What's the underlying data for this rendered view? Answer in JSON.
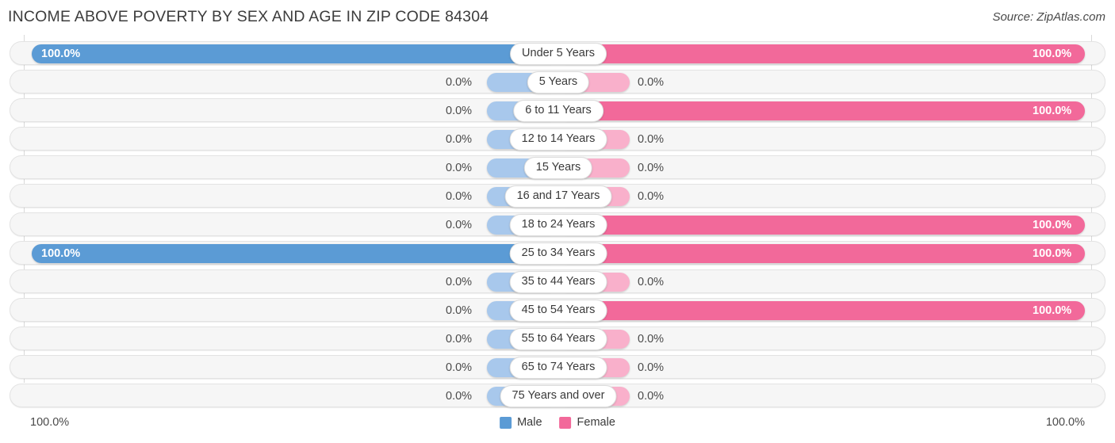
{
  "header": {
    "title": "INCOME ABOVE POVERTY BY SEX AND AGE IN ZIP CODE 84304",
    "source": "Source: ZipAtlas.com"
  },
  "footer": {
    "axis_left": "100.0%",
    "axis_right": "100.0%"
  },
  "legend": [
    {
      "label": "Male",
      "color": "#5b9bd5"
    },
    {
      "label": "Female",
      "color": "#f2699a"
    }
  ],
  "colors": {
    "male": "#5b9bd5",
    "female": "#f2699a",
    "male_zero": "#a8c8ec",
    "female_zero": "#f9b0cb",
    "track": "#f6f6f6",
    "track_border": "#e3e3e3",
    "gridline": "#d9d9d9"
  },
  "chart_data": {
    "type": "bar",
    "title": "INCOME ABOVE POVERTY BY SEX AND AGE IN ZIP CODE 84304",
    "subtitle": "Source: ZipAtlas.com",
    "orientation": "horizontal-diverging",
    "xlabel": "",
    "ylabel": "",
    "xlim": [
      0,
      100
    ],
    "grid": true,
    "legend_position": "bottom-center",
    "categories": [
      "Under 5 Years",
      "5 Years",
      "6 to 11 Years",
      "12 to 14 Years",
      "15 Years",
      "16 and 17 Years",
      "18 to 24 Years",
      "25 to 34 Years",
      "35 to 44 Years",
      "45 to 54 Years",
      "55 to 64 Years",
      "65 to 74 Years",
      "75 Years and over"
    ],
    "series": [
      {
        "name": "Male",
        "color": "#5b9bd5",
        "values": [
          100.0,
          0.0,
          0.0,
          0.0,
          0.0,
          0.0,
          0.0,
          100.0,
          0.0,
          0.0,
          0.0,
          0.0,
          0.0
        ],
        "labels": [
          "100.0%",
          "0.0%",
          "0.0%",
          "0.0%",
          "0.0%",
          "0.0%",
          "0.0%",
          "100.0%",
          "0.0%",
          "0.0%",
          "0.0%",
          "0.0%",
          "0.0%"
        ]
      },
      {
        "name": "Female",
        "color": "#f2699a",
        "values": [
          100.0,
          0.0,
          100.0,
          0.0,
          0.0,
          0.0,
          100.0,
          100.0,
          0.0,
          100.0,
          0.0,
          0.0,
          0.0
        ],
        "labels": [
          "100.0%",
          "0.0%",
          "100.0%",
          "0.0%",
          "0.0%",
          "0.0%",
          "100.0%",
          "100.0%",
          "0.0%",
          "100.0%",
          "0.0%",
          "0.0%",
          "0.0%"
        ]
      }
    ]
  }
}
